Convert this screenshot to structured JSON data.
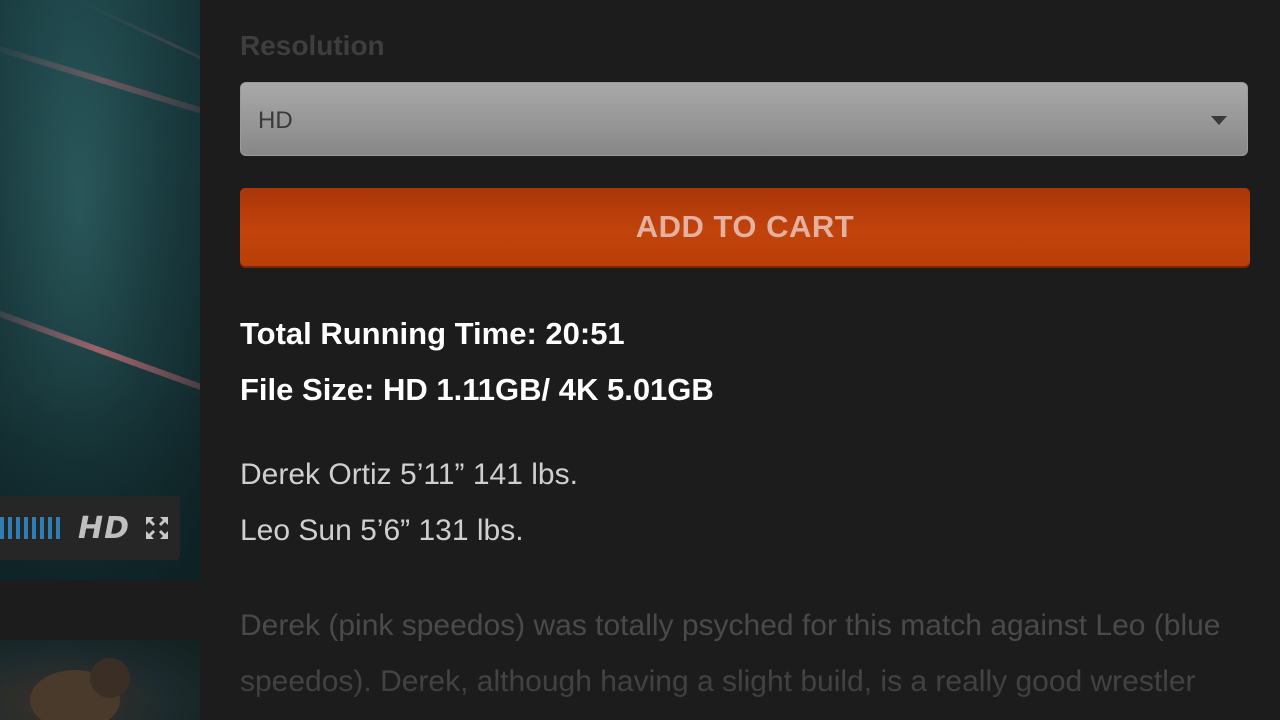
{
  "video": {
    "quality_badge": "HD",
    "volume_level_bars": 8
  },
  "product": {
    "resolution_label": "Resolution",
    "resolution_selected": "HD",
    "add_to_cart_label": "ADD TO CART",
    "running_time": "Total Running Time: 20:51",
    "file_size": "File Size: HD 1.11GB/ 4K 5.01GB",
    "stats": [
      "Derek Ortiz 5’11” 141 lbs.",
      "Leo Sun 5’6” 131 lbs."
    ],
    "description": "Derek (pink speedos) was totally psyched for this match against Leo (blue speedos).   Derek, although having a slight build, is a really good wrestler"
  },
  "colors": {
    "accent_button": "#c2430b",
    "volume_blue": "#2e7fb2",
    "background": "#1c1c1c"
  },
  "icons": {
    "fullscreen": "fullscreen-icon",
    "dropdown": "chevron-down-icon"
  }
}
